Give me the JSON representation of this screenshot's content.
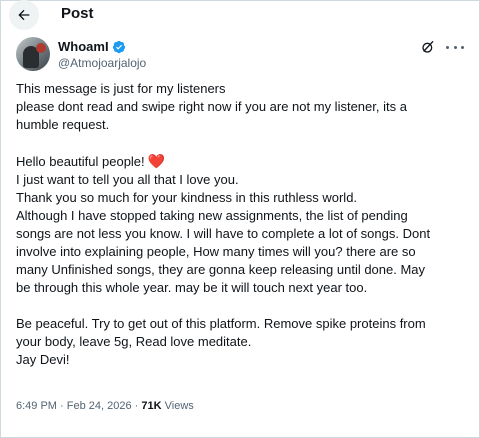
{
  "header": {
    "title": "Post",
    "back_icon": "arrow-left-icon"
  },
  "author": {
    "display_name": "WhoamI",
    "handle": "@Atmojoarjalojo",
    "verified": true,
    "verified_color": "#1d9bf0",
    "avatar_icon": "user-avatar",
    "grok_icon": "grok-icon",
    "more_icon": "more-dots-icon"
  },
  "post": {
    "lines": [
      "This message is just for my listeners",
      "please dont read and swipe right now if you are not my listener, its a",
      "humble request.",
      "",
      "Hello beautiful people!",
      "I just want to tell you all that I love you.",
      "Thank you so much for your kindness in this ruthless world.",
      "Although I have stopped taking new assignments, the list of pending",
      "songs are not less you know. I will have to complete a lot of songs. Dont",
      "involve into explaining people, How many times will you? there are so",
      "many Unfinished songs, they are gonna keep releasing until done. May",
      "be through this whole year. may be it will touch next year too.",
      "",
      "Be peaceful. Try to get out of this platform. Remove spike proteins from",
      "your body, leave 5g, Read love meditate.",
      "Jay Devi!"
    ],
    "heart_emoji": "❤️",
    "heart_color": "#e0245e"
  },
  "meta": {
    "time": "6:49 PM",
    "separator": "·",
    "date": "Feb 24, 2026",
    "views_count": "71K",
    "views_label": "Views"
  }
}
